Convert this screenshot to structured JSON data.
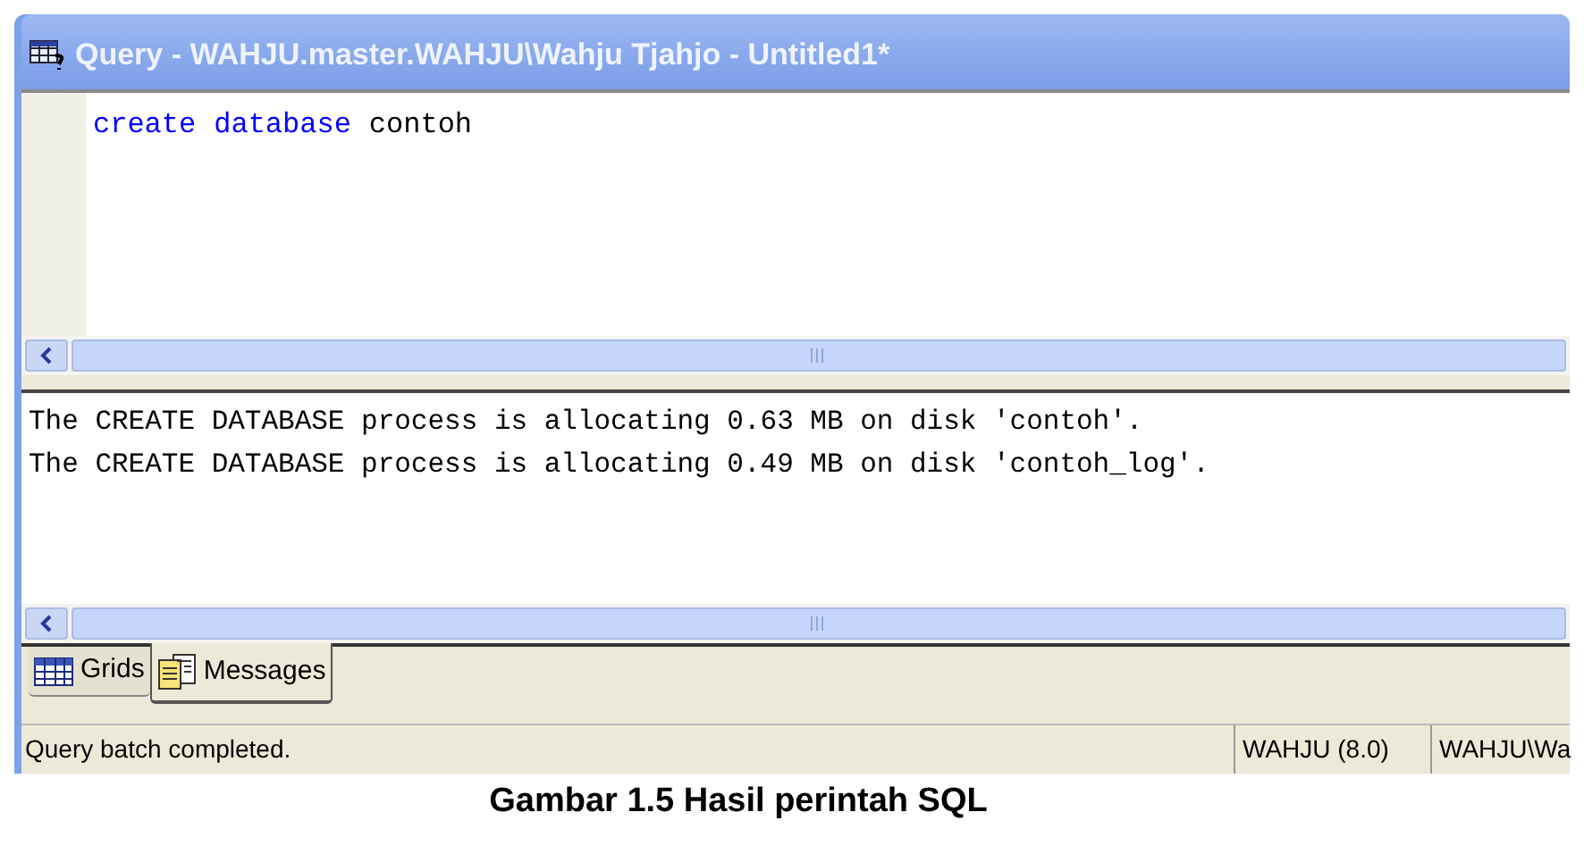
{
  "window": {
    "title": "Query - WAHJU.master.WAHJU\\Wahju Tjahjo - Untitled1*"
  },
  "editor": {
    "tokens": [
      {
        "text": "create",
        "kind": "keyword"
      },
      {
        "text": "database",
        "kind": "keyword"
      },
      {
        "text": "contoh",
        "kind": "identifier"
      }
    ]
  },
  "messages": [
    "The CREATE DATABASE process is allocating 0.63 MB on disk 'contoh'.",
    "The CREATE DATABASE process is allocating 0.49 MB on disk 'contoh_log'."
  ],
  "tabs": [
    {
      "label": "Grids",
      "selected": false
    },
    {
      "label": "Messages",
      "selected": true
    }
  ],
  "status_bar": {
    "message": "Query batch completed.",
    "server": "WAHJU (8.0)",
    "user": "WAHJU\\Wa"
  },
  "caption": "Gambar 1.5 Hasil perintah SQL"
}
